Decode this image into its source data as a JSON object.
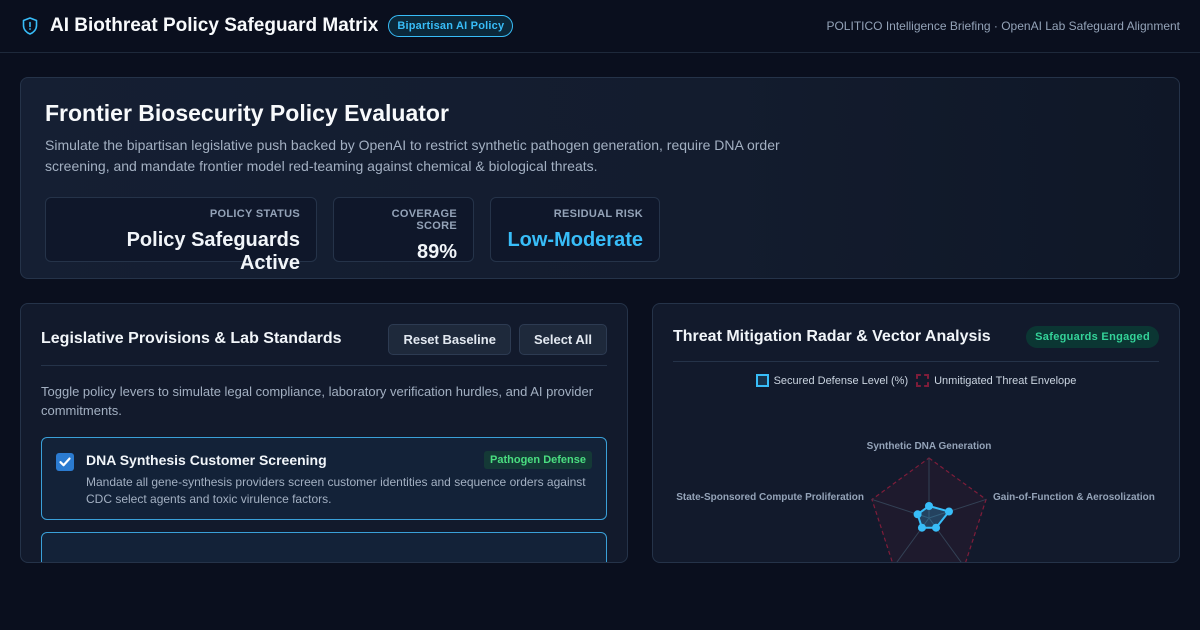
{
  "header": {
    "title": "AI Biothreat Policy Safeguard Matrix",
    "badge": "Bipartisan AI Policy",
    "subtitle": "POLITICO Intelligence Briefing · OpenAI Lab Safeguard Alignment"
  },
  "hero": {
    "title": "Frontier Biosecurity Policy Evaluator",
    "description": "Simulate the bipartisan legislative push backed by OpenAI to restrict synthetic pathogen generation, require DNA order screening, and mandate frontier model red-teaming against chemical & biological threats.",
    "stats": [
      {
        "label": "POLICY STATUS",
        "value": "Policy Safeguards Active"
      },
      {
        "label": "COVERAGE SCORE",
        "value": "89%"
      },
      {
        "label": "RESIDUAL RISK",
        "value": "Low-Moderate"
      }
    ]
  },
  "provisions_panel": {
    "title": "Legislative Provisions & Lab Standards",
    "reset_label": "Reset Baseline",
    "select_all_label": "Select All",
    "description": "Toggle policy levers to simulate legal compliance, laboratory verification hurdles, and AI provider commitments.",
    "items": [
      {
        "title": "DNA Synthesis Customer Screening",
        "tag": "Pathogen Defense",
        "description": "Mandate all gene-synthesis providers screen customer identities and sequence orders against CDC select agents and toxic virulence factors.",
        "checked": true
      }
    ]
  },
  "radar_panel": {
    "title": "Threat Mitigation Radar & Vector Analysis",
    "badge": "Safeguards Engaged",
    "legend": [
      "Secured Defense Level (%)",
      "Unmitigated Threat Envelope"
    ],
    "colors": {
      "defense": "#38bdf8",
      "threat": "#7f1d3a"
    },
    "axes": [
      "Synthetic DNA Generation",
      "Gain-of-Function & Aerosolization",
      "",
      "",
      "State-Sponsored Compute Proliferation"
    ],
    "defense_levels": [
      0.2,
      0.35,
      0.2,
      0.2,
      0.2
    ],
    "threat_levels": [
      1,
      1,
      1,
      1,
      1
    ]
  }
}
